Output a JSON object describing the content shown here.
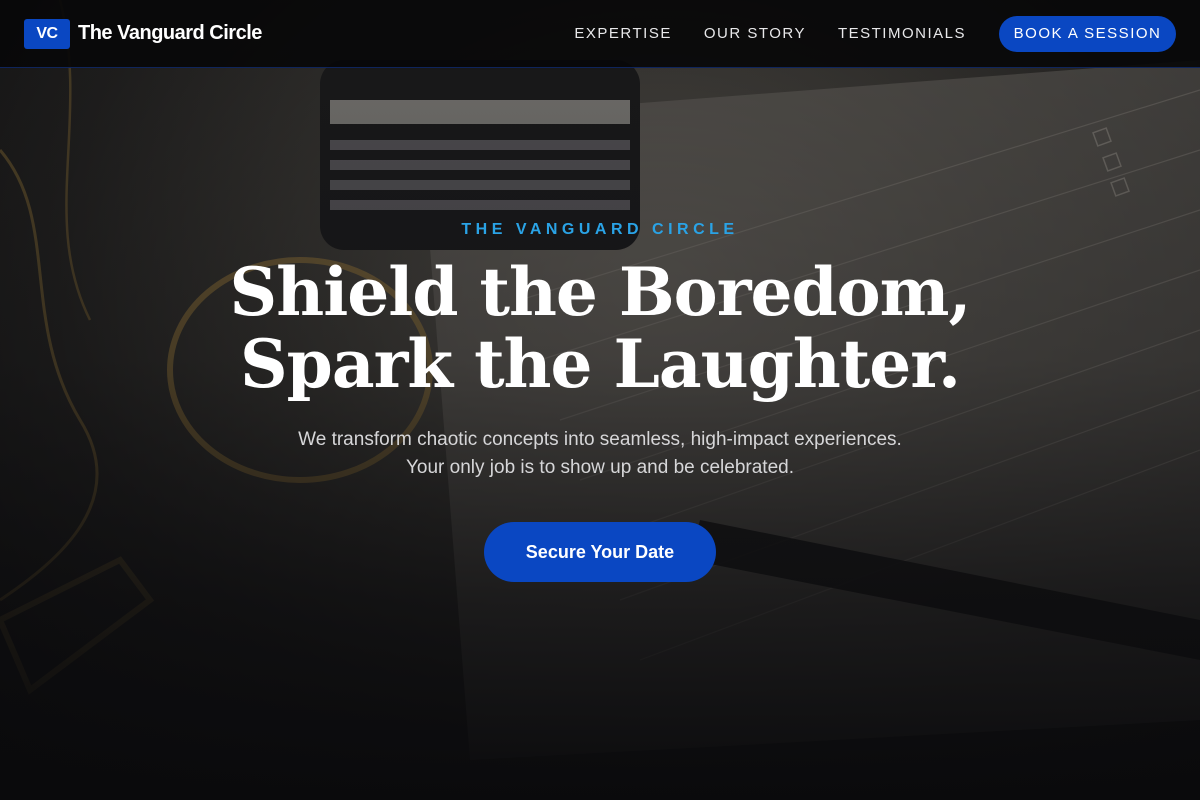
{
  "brand": {
    "badge": "VC",
    "name": "The Vanguard Circle"
  },
  "nav": {
    "links": [
      {
        "label": "EXPERTISE"
      },
      {
        "label": "OUR STORY"
      },
      {
        "label": "TESTIMONIALS"
      }
    ],
    "cta_label": "BOOK A SESSION"
  },
  "hero": {
    "eyebrow": "THE VANGUARD CIRCLE",
    "headline_line1": "Shield the Boredom,",
    "headline_line2": "Spark the Laughter.",
    "subtext": "We transform chaotic concepts into seamless, high-impact experiences. Your only job is to show up and be celebrated.",
    "cta_label": "Secure Your Date"
  },
  "colors": {
    "accent": "#0a47c2",
    "eyebrow": "#2aa3e6",
    "nav_bg": "#080809"
  }
}
